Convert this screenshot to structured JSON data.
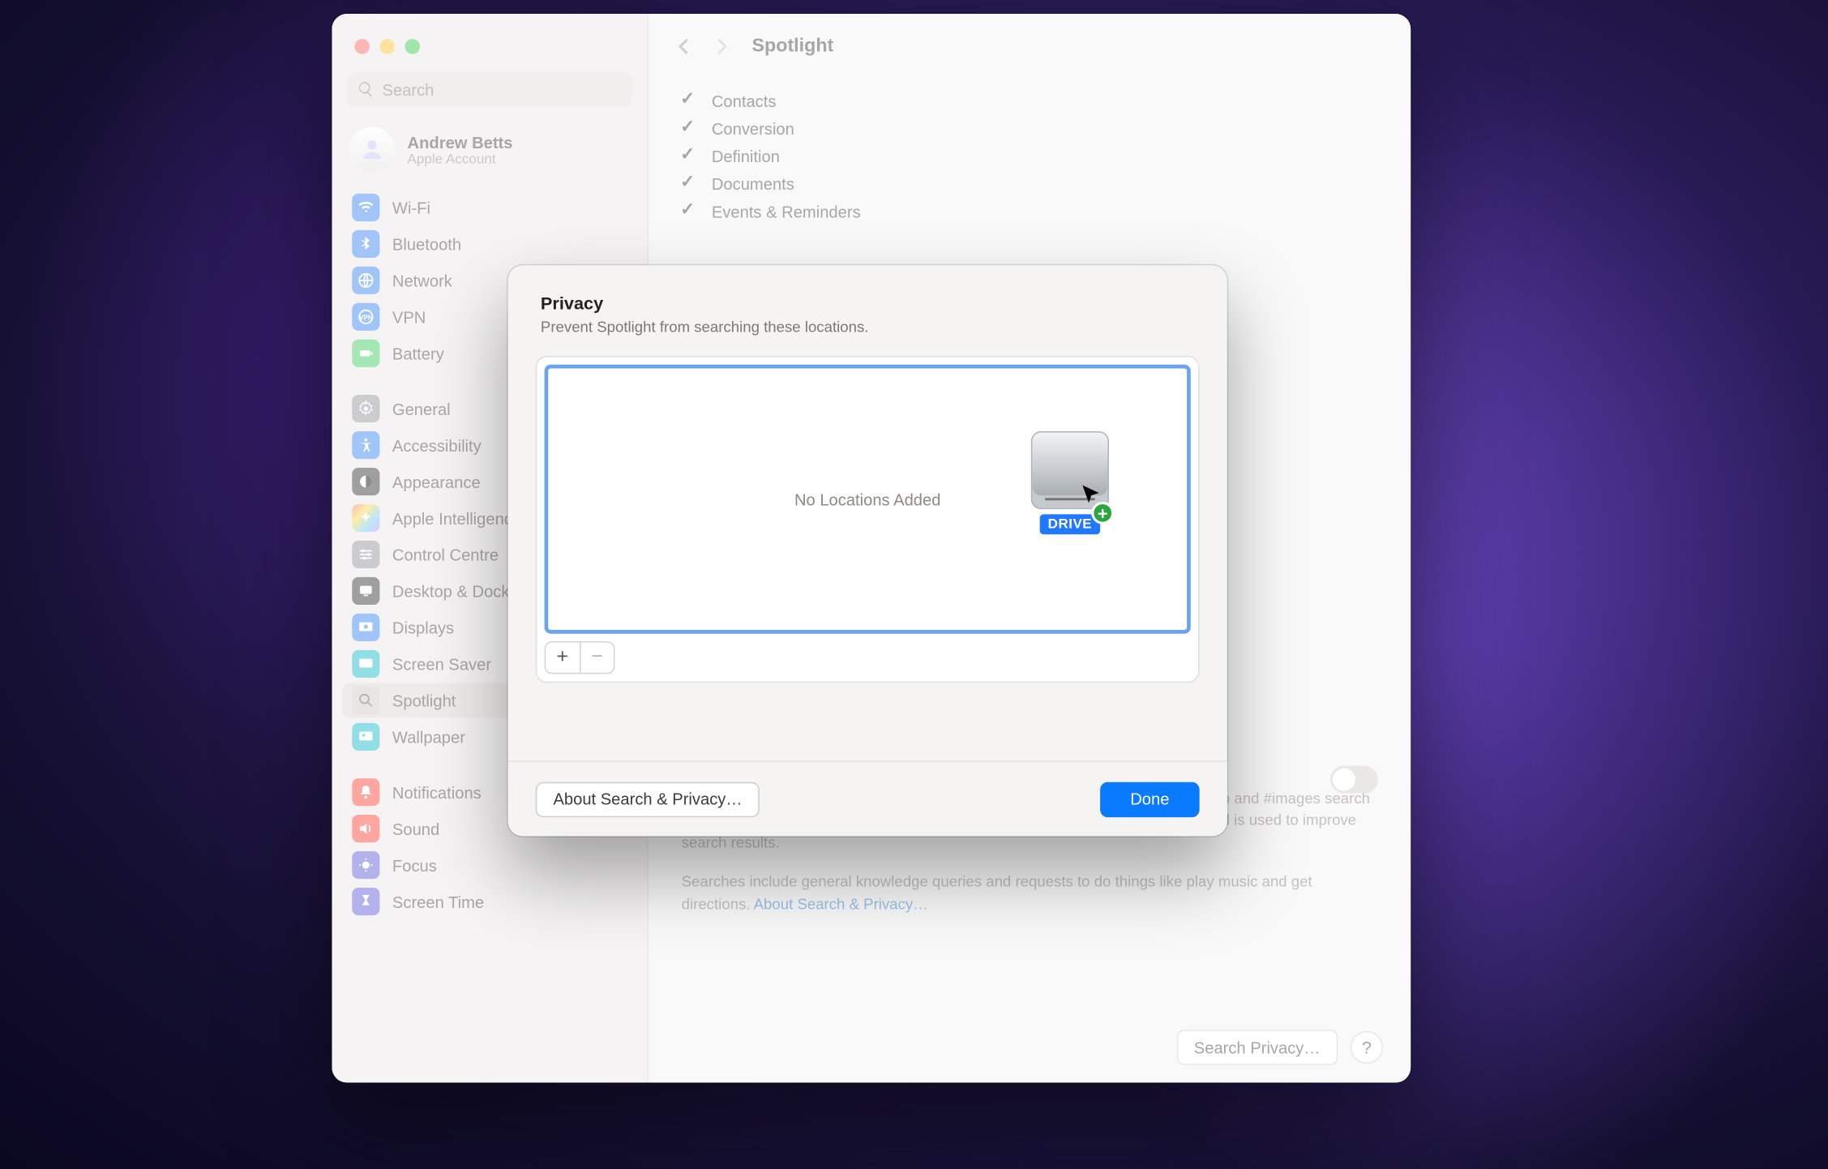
{
  "window": {
    "title": "Spotlight"
  },
  "search": {
    "placeholder": "Search"
  },
  "account": {
    "name": "Andrew Betts",
    "sub": "Apple Account"
  },
  "sidebar": {
    "groups": [
      {
        "items": [
          {
            "label": "Wi-Fi",
            "icon": "wifi-icon",
            "color": "ic-blue"
          },
          {
            "label": "Bluetooth",
            "icon": "bluetooth-icon",
            "color": "ic-blue"
          },
          {
            "label": "Network",
            "icon": "network-icon",
            "color": "ic-blue"
          },
          {
            "label": "VPN",
            "icon": "vpn-icon",
            "color": "ic-blue"
          },
          {
            "label": "Battery",
            "icon": "battery-icon",
            "color": "ic-green"
          }
        ]
      },
      {
        "items": [
          {
            "label": "General",
            "icon": "gear-icon",
            "color": "ic-grey"
          },
          {
            "label": "Accessibility",
            "icon": "accessibility-icon",
            "color": "ic-blue"
          },
          {
            "label": "Appearance",
            "icon": "appearance-icon",
            "color": "ic-black"
          },
          {
            "label": "Apple Intelligence",
            "icon": "sparkle-icon",
            "color": "ic-multi"
          },
          {
            "label": "Control Centre",
            "icon": "sliders-icon",
            "color": "ic-grey"
          },
          {
            "label": "Desktop & Dock",
            "icon": "desktop-icon",
            "color": "ic-black"
          },
          {
            "label": "Displays",
            "icon": "displays-icon",
            "color": "ic-blue"
          },
          {
            "label": "Screen Saver",
            "icon": "screensaver-icon",
            "color": "ic-teal"
          },
          {
            "label": "Spotlight",
            "icon": "search-icon",
            "color": "ic-grey2",
            "selected": true
          },
          {
            "label": "Wallpaper",
            "icon": "wallpaper-icon",
            "color": "ic-teal"
          }
        ]
      },
      {
        "items": [
          {
            "label": "Notifications",
            "icon": "bell-icon",
            "color": "ic-red"
          },
          {
            "label": "Sound",
            "icon": "sound-icon",
            "color": "ic-red"
          },
          {
            "label": "Focus",
            "icon": "focus-icon",
            "color": "ic-purple"
          },
          {
            "label": "Screen Time",
            "icon": "hourglass-icon",
            "color": "ic-purple"
          }
        ]
      }
    ]
  },
  "main": {
    "categories": [
      "Contacts",
      "Conversion",
      "Definition",
      "Documents",
      "Events & Reminders"
    ],
    "improve": {
      "toggle": false,
      "line1": "Help improve Search by allowing Apple to store your Safari, Siri, Spotlight, Lookup and #images search queries. The information collected is stored in a way that does not identify you and is used to improve search results.",
      "line2_a": "Searches include general knowledge queries and requests to do things like play music and get directions. ",
      "line2_link": "About Search & Privacy…"
    },
    "footer": {
      "privacy_btn": "Search Privacy…",
      "help": "?"
    }
  },
  "sheet": {
    "title": "Privacy",
    "subtitle": "Prevent Spotlight from searching these locations.",
    "placeholder": "No Locations Added",
    "drive_label": "DRIVE",
    "about_btn": "About Search & Privacy…",
    "done_btn": "Done"
  }
}
